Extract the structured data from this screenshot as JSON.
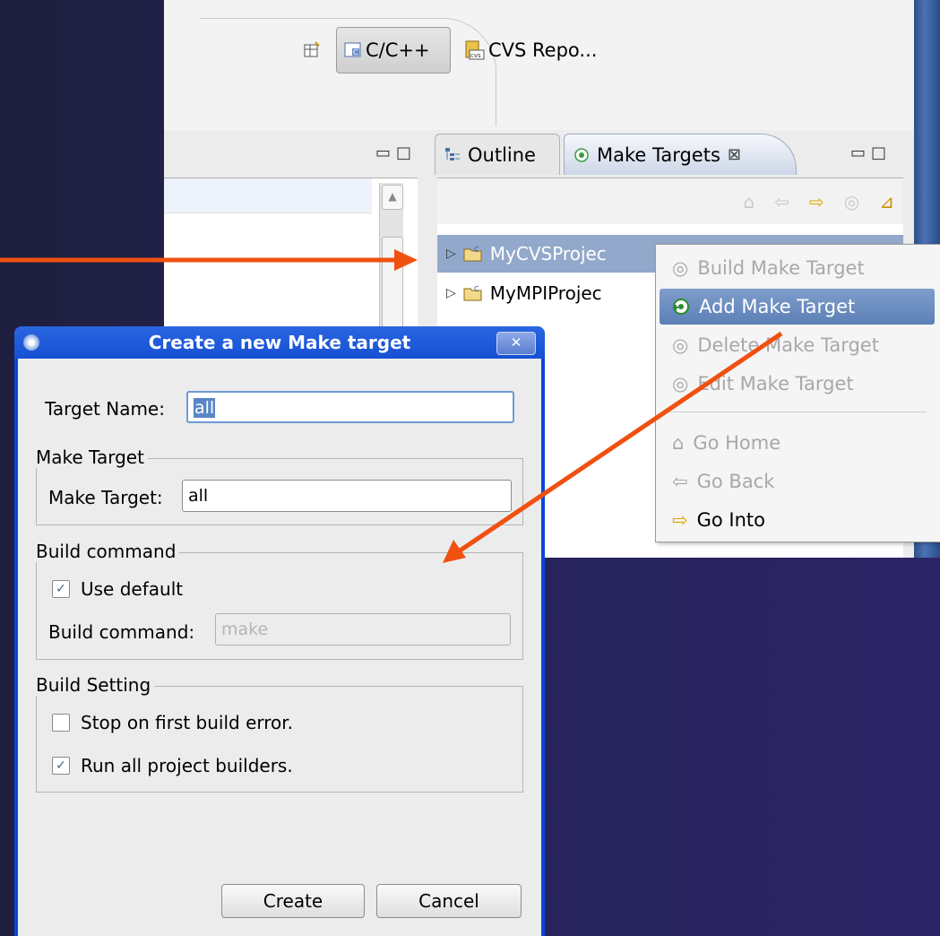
{
  "perspectives": {
    "open_icon": "open-perspective-icon",
    "cpp_label": "C/C++",
    "cvs_label": "CVS Repo..."
  },
  "views": {
    "outline_tab": "Outline",
    "make_targets_tab": "Make Targets",
    "close_glyph": "⊠"
  },
  "tree": {
    "items": [
      "MyCVSProjec",
      "MyMPIProjec"
    ]
  },
  "context_menu": {
    "build": "Build Make Target",
    "add": "Add Make Target",
    "delete": "Delete Make Target",
    "edit": "Edit Make Target",
    "go_home": "Go Home",
    "go_back": "Go Back",
    "go_into": "Go Into"
  },
  "dialog": {
    "title": "Create a new Make target",
    "target_name_label": "Target Name:",
    "target_name_value": "all",
    "make_target_group": "Make Target",
    "make_target_label": "Make Target:",
    "make_target_value": "all",
    "build_command_group": "Build command",
    "use_default_label": "Use default",
    "use_default_checked": true,
    "build_command_label": "Build command:",
    "build_command_value": "make",
    "build_setting_group": "Build Setting",
    "stop_on_error_label": "Stop on first build error.",
    "stop_on_error_checked": false,
    "run_builders_label": "Run all project builders.",
    "run_builders_checked": true,
    "create_button": "Create",
    "cancel_button": "Cancel"
  },
  "colors": {
    "annotation_arrow": "#f05010",
    "selection": "#93a9cb",
    "dialog_title": "#1550d4"
  }
}
